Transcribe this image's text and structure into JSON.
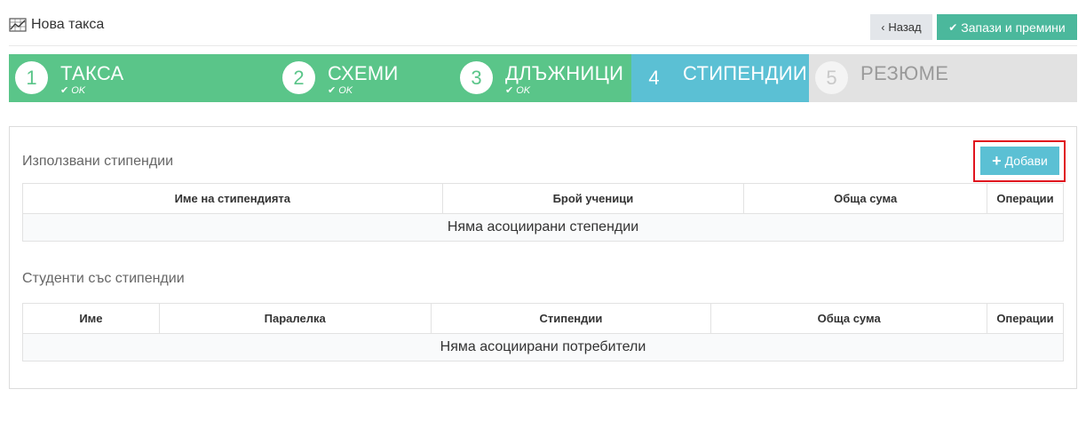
{
  "header": {
    "title": "Нова такса",
    "title_icon": "graph-paper-icon",
    "back_label": "Назад",
    "save_label": "Запази и премини"
  },
  "wizard": {
    "steps": [
      {
        "number": "1",
        "label": "ТАКСА",
        "status": "OK",
        "state": "done"
      },
      {
        "number": "2",
        "label": "СХЕМИ",
        "status": "OK",
        "state": "done"
      },
      {
        "number": "3",
        "label": "ДЛЪЖНИЦИ",
        "status": "OK",
        "state": "done"
      },
      {
        "number": "4",
        "label": "СТИПЕНДИИ",
        "status": "",
        "state": "active"
      },
      {
        "number": "5",
        "label": "РЕЗЮМЕ",
        "status": "",
        "state": "todo"
      }
    ]
  },
  "scholarships": {
    "title": "Използвани стипендии",
    "add_label": "Добави",
    "columns": [
      "Име на стипендията",
      "Брой ученици",
      "Обща сума",
      "Операции"
    ],
    "empty_text": "Няма асоциирани степендии"
  },
  "students": {
    "title": "Студенти със стипендии",
    "columns": [
      "Име",
      "Паралелка",
      "Стипендии",
      "Обща сума",
      "Операции"
    ],
    "empty_text": "Няма асоциирани потребители"
  },
  "colors": {
    "done": "#5ac589",
    "active": "#5bc0d4",
    "todo": "#e2e2e2",
    "save": "#4bb89c",
    "highlight": "#e0141e"
  }
}
